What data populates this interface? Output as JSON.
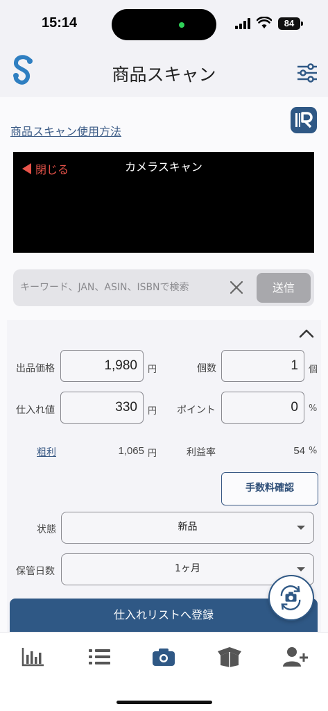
{
  "status_bar": {
    "time": "15:14",
    "battery": "84"
  },
  "header": {
    "title": "商品スキャン",
    "logo_icon": "app-logo-icon",
    "settings_icon": "sliders-icon"
  },
  "scan": {
    "help_link": "商品スキャン使用方法",
    "barcode_icon": "barcode-reader-icon",
    "camera_title": "カメラスキャン",
    "close_label": "閉じる"
  },
  "search": {
    "placeholder": "キーワード、JAN、ASIN、ISBNで検索",
    "value": "",
    "send_label": "送信"
  },
  "form": {
    "listing_price_label": "出品価格",
    "listing_price_value": "1,980",
    "listing_price_unit": "円",
    "quantity_label": "個数",
    "quantity_value": "1",
    "quantity_unit": "個",
    "cost_label": "仕入れ値",
    "cost_value": "330",
    "cost_unit": "円",
    "points_label": "ポイント",
    "points_value": "0",
    "points_unit": "%",
    "gross_profit_label": "粗利",
    "gross_profit_value": "1,065",
    "gross_profit_unit": "円",
    "profit_rate_label": "利益率",
    "profit_rate_value": "54",
    "profit_rate_unit": "%",
    "fee_button_label": "手数料確認",
    "condition_label": "状態",
    "condition_value": "新品",
    "storage_label": "保管日数",
    "storage_value": "1ヶ月",
    "register_button_label": "仕入れリストへ登録"
  },
  "tabs": [
    {
      "icon": "bar-chart-icon"
    },
    {
      "icon": "list-icon"
    },
    {
      "icon": "camera-icon"
    },
    {
      "icon": "box-icon"
    },
    {
      "icon": "add-user-icon"
    }
  ],
  "colors": {
    "primary": "#2f5885",
    "accent_red": "#e8534a",
    "background": "#f4f4f8"
  }
}
